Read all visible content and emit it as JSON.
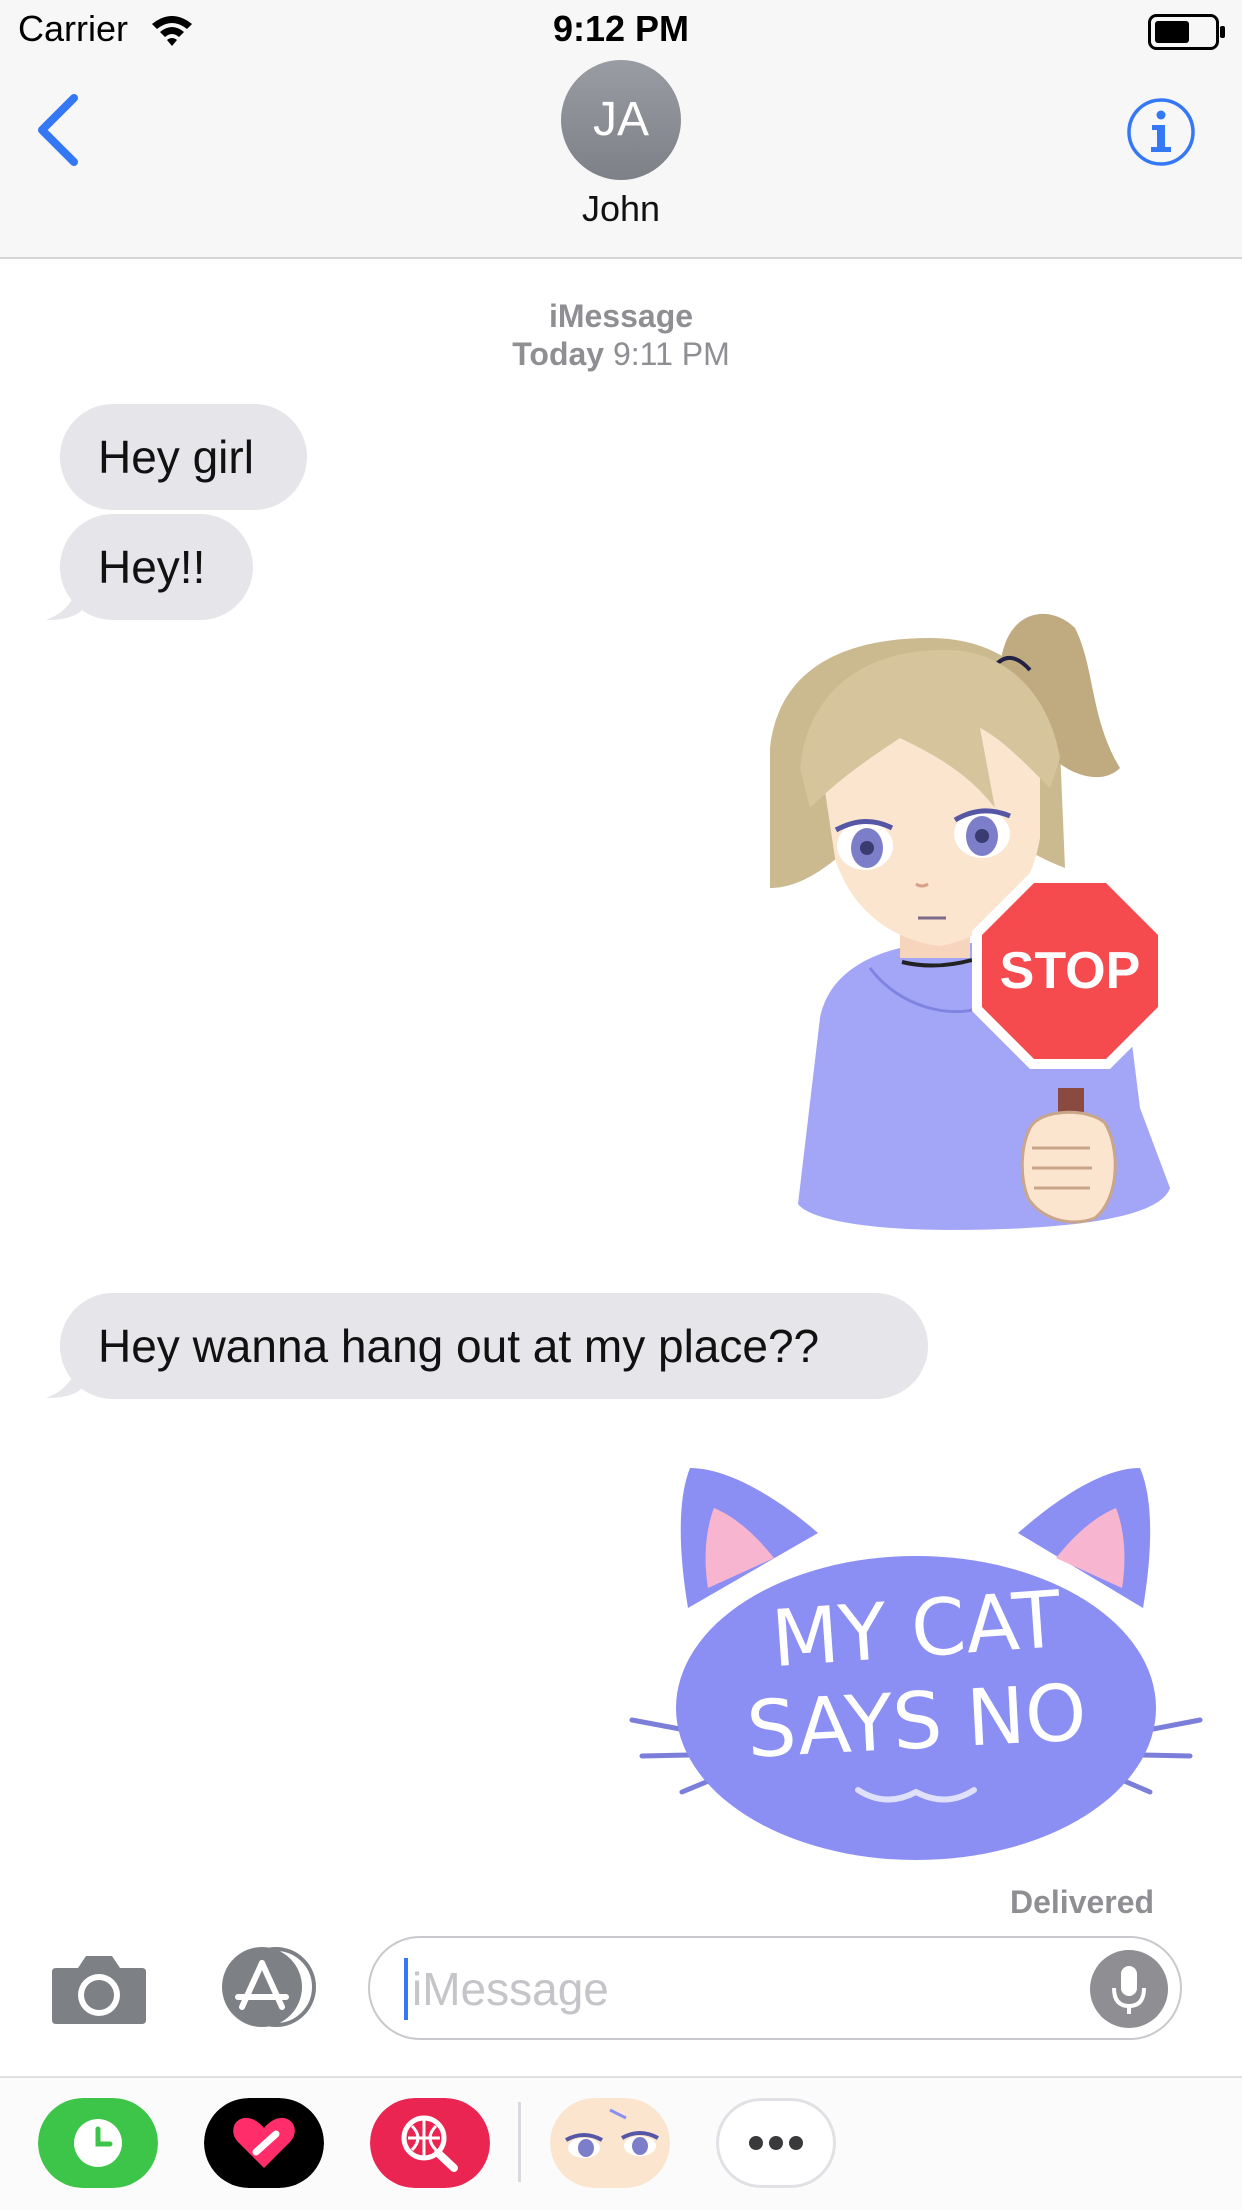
{
  "status_bar": {
    "carrier": "Carrier",
    "time": "9:12 PM"
  },
  "nav": {
    "avatar_initials": "JA",
    "contact_name": "John",
    "icons": [
      "back-chevron-icon",
      "info-icon"
    ]
  },
  "conversation": {
    "service": "iMessage",
    "timestamp_day": "Today",
    "timestamp_time": "9:11 PM",
    "messages": [
      {
        "direction": "incoming",
        "type": "text",
        "text": "Hey girl"
      },
      {
        "direction": "incoming",
        "type": "text",
        "text": "Hey!!"
      },
      {
        "direction": "outgoing",
        "type": "sticker",
        "sticker": "girl-holding-stop-sign",
        "sign_text": "STOP"
      },
      {
        "direction": "incoming",
        "type": "text",
        "text": "Hey wanna hang out at my place??"
      },
      {
        "direction": "outgoing",
        "type": "sticker",
        "sticker": "cat-head",
        "line1": "MY CAT",
        "line2": "SAYS NO"
      }
    ],
    "delivery_status": "Delivered"
  },
  "input": {
    "placeholder": "iMessage"
  },
  "app_drawer": {
    "apps": [
      "recents-icon",
      "digital-touch-icon",
      "web-image-search-icon",
      "sticker-pack-icon",
      "more-icon"
    ]
  },
  "colors": {
    "accent": "#3478f6",
    "incoming_bubble": "#e5e5ea",
    "stop_sign": "#f54b4f",
    "cat": "#8b8ef2"
  }
}
